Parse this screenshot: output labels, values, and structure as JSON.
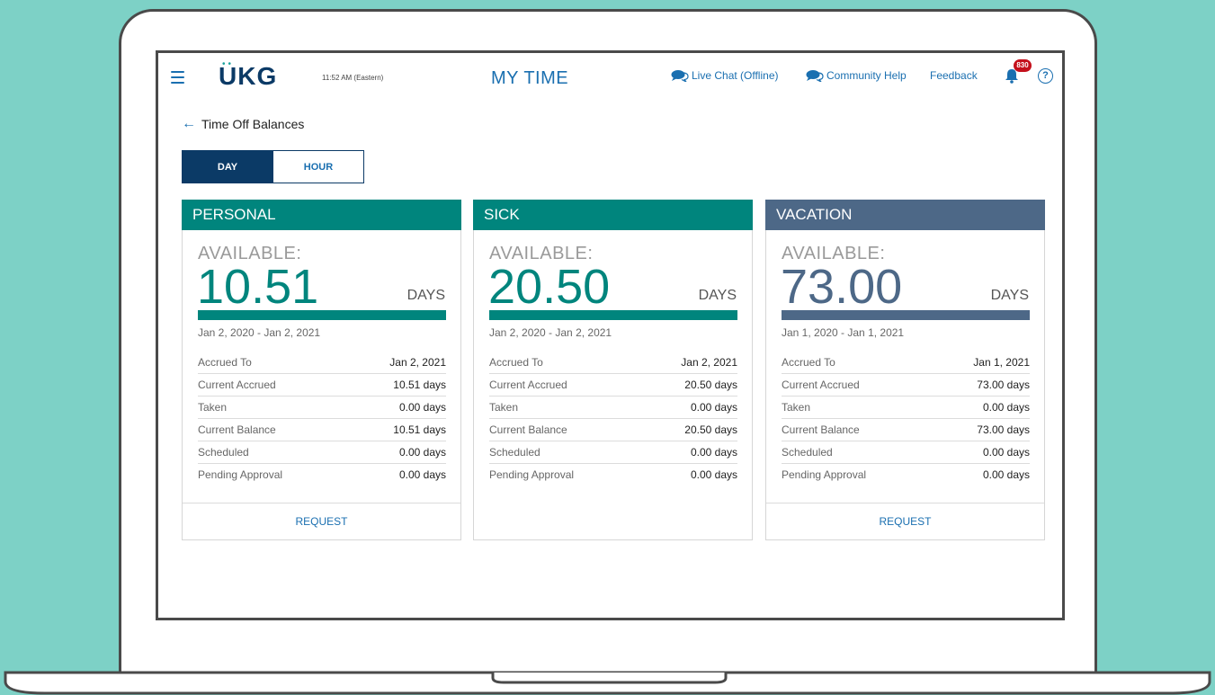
{
  "header": {
    "logo": "UKG",
    "time": "11:52 AM (Eastern)",
    "title": "MY TIME",
    "links": [
      {
        "label": "Live Chat (Offline)",
        "icon": "chat-icon"
      },
      {
        "label": "Community Help",
        "icon": "chat-icon"
      },
      {
        "label": "Feedback"
      }
    ],
    "notification_count": "830",
    "help_label": "?"
  },
  "page": {
    "back_label": "Time Off Balances",
    "units_toggle": {
      "selected": "DAY",
      "options": [
        "DAY",
        "HOUR"
      ]
    }
  },
  "colors": {
    "teal": "#00857d",
    "slate": "#4d6887",
    "navy": "#0b3a66",
    "link": "#1a6fb0",
    "badge": "#c4101c"
  },
  "cards": [
    {
      "title": "PERSONAL",
      "available_label": "AVAILABLE:",
      "available_value": "10.51",
      "unit": "DAYS",
      "period": "Jan 2, 2020 - Jan 2, 2021",
      "rows": [
        {
          "label": "Accrued To",
          "value": "Jan 2, 2021"
        },
        {
          "label": "Current Accrued",
          "value": "10.51 days"
        },
        {
          "label": "Taken",
          "value": "0.00 days"
        },
        {
          "label": "Current Balance",
          "value": "10.51 days"
        },
        {
          "label": "Scheduled",
          "value": "0.00 days"
        },
        {
          "label": "Pending Approval",
          "value": "0.00 days"
        }
      ],
      "action": "REQUEST"
    },
    {
      "title": "SICK",
      "available_label": "AVAILABLE:",
      "available_value": "20.50",
      "unit": "DAYS",
      "period": "Jan 2, 2020 - Jan 2, 2021",
      "rows": [
        {
          "label": "Accrued To",
          "value": "Jan 2, 2021"
        },
        {
          "label": "Current Accrued",
          "value": "20.50 days"
        },
        {
          "label": "Taken",
          "value": "0.00 days"
        },
        {
          "label": "Current Balance",
          "value": "20.50 days"
        },
        {
          "label": "Scheduled",
          "value": "0.00 days"
        },
        {
          "label": "Pending Approval",
          "value": "0.00 days"
        }
      ],
      "action": ""
    },
    {
      "title": "VACATION",
      "available_label": "AVAILABLE:",
      "available_value": "73.00",
      "unit": "DAYS",
      "period": "Jan 1, 2020 - Jan 1, 2021",
      "rows": [
        {
          "label": "Accrued To",
          "value": "Jan 1, 2021"
        },
        {
          "label": "Current Accrued",
          "value": "73.00 days"
        },
        {
          "label": "Taken",
          "value": "0.00 days"
        },
        {
          "label": "Current Balance",
          "value": "73.00 days"
        },
        {
          "label": "Scheduled",
          "value": "0.00 days"
        },
        {
          "label": "Pending Approval",
          "value": "0.00 days"
        }
      ],
      "action": "REQUEST"
    }
  ]
}
